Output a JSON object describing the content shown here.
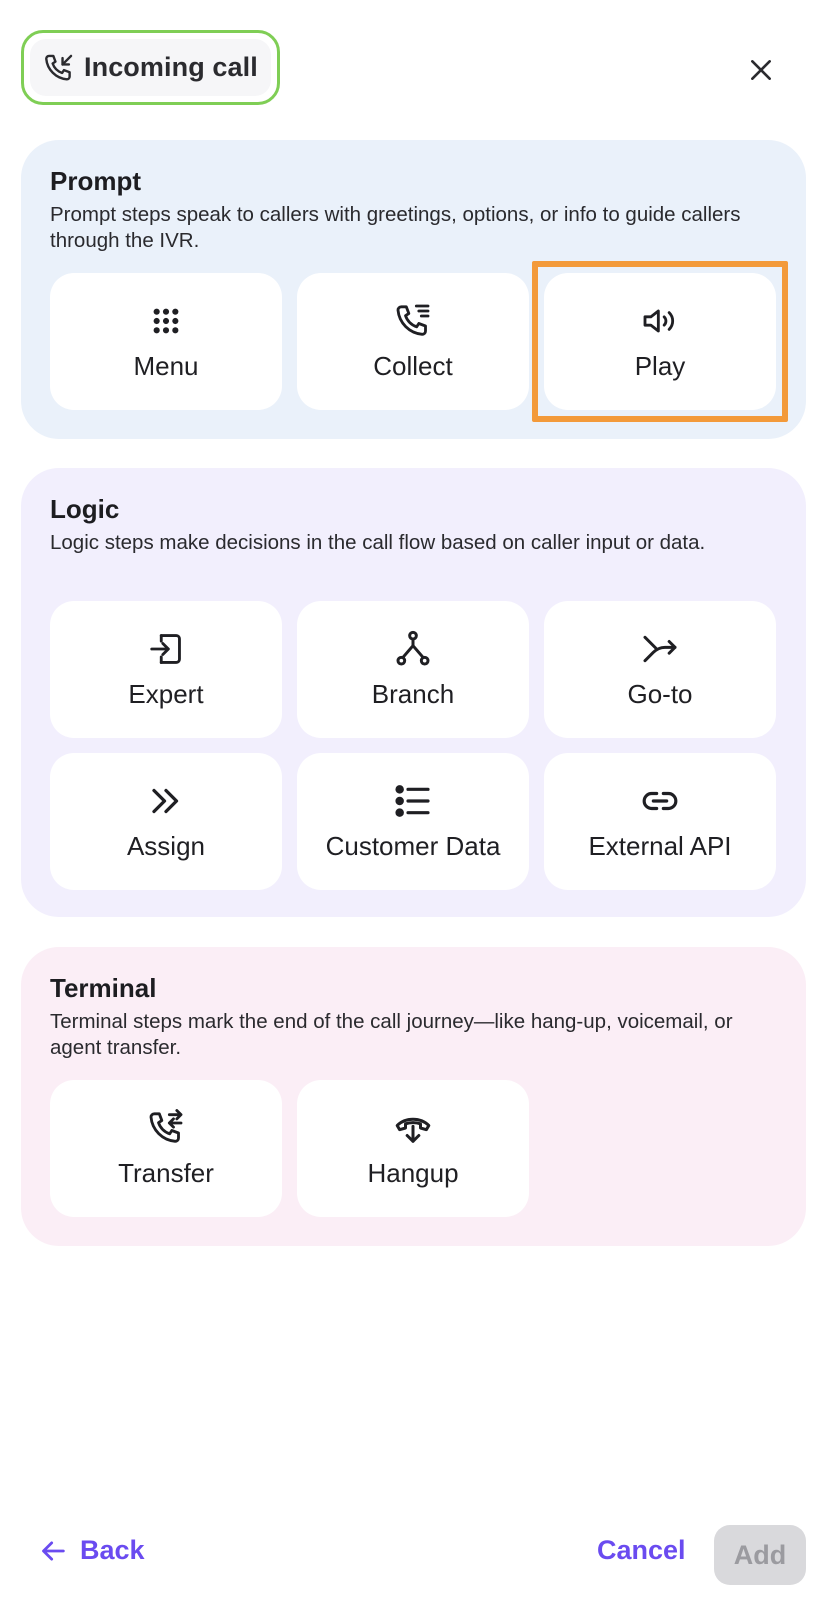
{
  "header": {
    "trigger_label": "Incoming call",
    "trigger_icon": "phone-incoming-icon",
    "close_icon": "close-icon"
  },
  "sections": {
    "prompt": {
      "title": "Prompt",
      "description": "Prompt steps speak to callers with greetings, options, or info to guide callers through the IVR.",
      "items": [
        {
          "label": "Menu",
          "icon": "grid-dots-icon"
        },
        {
          "label": "Collect",
          "icon": "phone-list-icon"
        },
        {
          "label": "Play",
          "icon": "speaker-icon",
          "selected": true
        }
      ]
    },
    "logic": {
      "title": "Logic",
      "description": "Logic steps make decisions in the call flow based on caller input or data.",
      "items": [
        {
          "label": "Expert",
          "icon": "enter-box-icon"
        },
        {
          "label": "Branch",
          "icon": "branch-icon"
        },
        {
          "label": "Go-to",
          "icon": "shuffle-arrow-icon"
        },
        {
          "label": "Assign",
          "icon": "double-chevron-icon"
        },
        {
          "label": "Customer Data",
          "icon": "list-icon"
        },
        {
          "label": "External API",
          "icon": "link-icon"
        }
      ]
    },
    "terminal": {
      "title": "Terminal",
      "description": "Terminal steps mark the end of the call journey—like hang-up, voicemail, or agent transfer.",
      "items": [
        {
          "label": "Transfer",
          "icon": "phone-transfer-icon"
        },
        {
          "label": "Hangup",
          "icon": "hangup-icon"
        }
      ]
    }
  },
  "footer": {
    "back_label": "Back",
    "cancel_label": "Cancel",
    "add_label": "Add"
  },
  "colors": {
    "accent": "#6a4bf0",
    "selection_outline": "#f39a3a",
    "trigger_border": "#7fce55",
    "prompt_bg": "#eaf1fa",
    "logic_bg": "#f2effd",
    "terminal_bg": "#fbeef6"
  }
}
